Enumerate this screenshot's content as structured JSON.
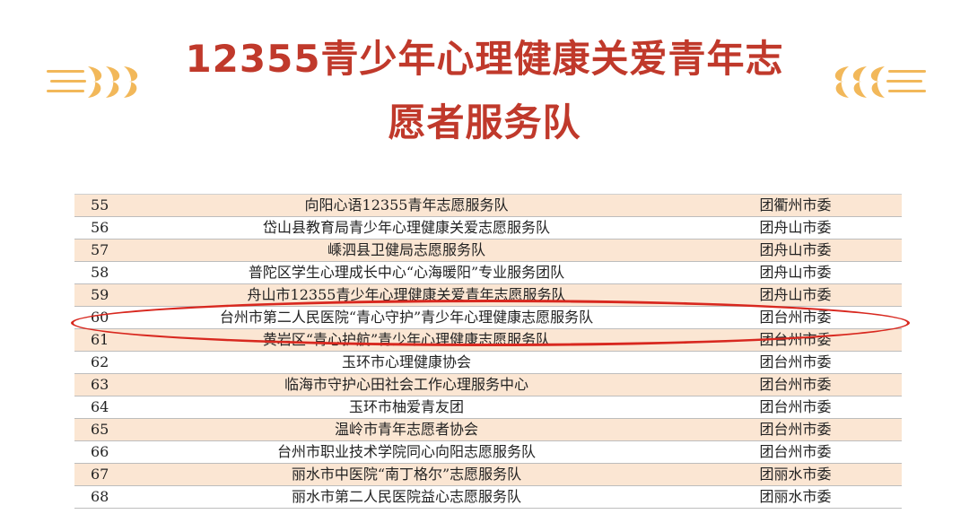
{
  "title": {
    "line1": "12355青少年心理健康关爱青年志",
    "line2": "愿者服务队",
    "color": "#c0392b"
  },
  "decoration": {
    "color": "#f2b85a",
    "icon": "wheat-ears-icon"
  },
  "table": {
    "shade_color": "#fbe6d3",
    "rows": [
      {
        "no": "55",
        "name": "向阳心语12355青年志愿服务队",
        "org": "团衢州市委"
      },
      {
        "no": "56",
        "name": "岱山县教育局青少年心理健康关爱志愿服务队",
        "org": "团舟山市委"
      },
      {
        "no": "57",
        "name": "嵊泗县卫健局志愿服务队",
        "org": "团舟山市委"
      },
      {
        "no": "58",
        "name": "普陀区学生心理成长中心“心海暖阳”专业服务团队",
        "org": "团舟山市委"
      },
      {
        "no": "59",
        "name": "舟山市12355青少年心理健康关爱青年志愿服务队",
        "org": "团舟山市委"
      },
      {
        "no": "60",
        "name": "台州市第二人民医院“青心守护”青少年心理健康志愿服务队",
        "org": "团台州市委"
      },
      {
        "no": "61",
        "name": "黄岩区“青心护航”青少年心理健康志愿服务队",
        "org": "团台州市委"
      },
      {
        "no": "62",
        "name": "玉环市心理健康协会",
        "org": "团台州市委"
      },
      {
        "no": "63",
        "name": "临海市守护心田社会工作心理服务中心",
        "org": "团台州市委"
      },
      {
        "no": "64",
        "name": "玉环市柚爱青友团",
        "org": "团台州市委"
      },
      {
        "no": "65",
        "name": "温岭市青年志愿者协会",
        "org": "团台州市委"
      },
      {
        "no": "66",
        "name": "台州市职业技术学院同心向阳志愿服务队",
        "org": "团台州市委"
      },
      {
        "no": "67",
        "name": "丽水市中医院“南丁格尔”志愿服务队",
        "org": "团丽水市委"
      },
      {
        "no": "68",
        "name": "丽水市第二人民医院益心志愿服务队",
        "org": "团丽水市委"
      }
    ]
  },
  "highlight": {
    "row_no": "60",
    "color": "#d8281f"
  }
}
